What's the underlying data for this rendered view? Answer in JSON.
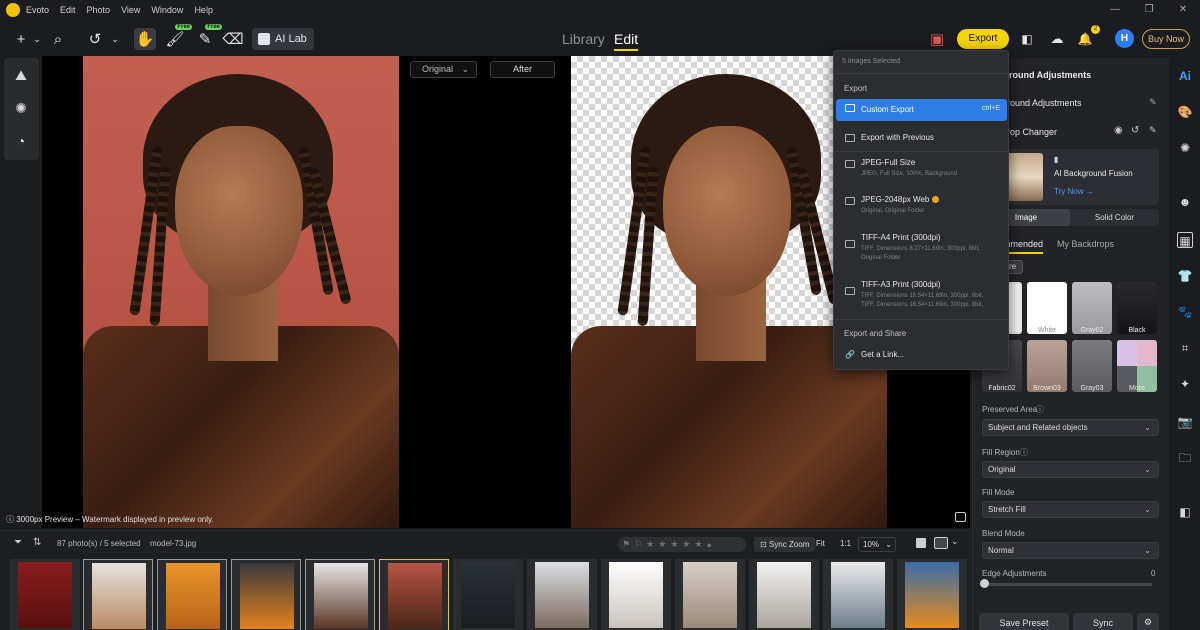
{
  "app": {
    "menu": [
      "Evoto",
      "Edit",
      "Photo",
      "View",
      "Window",
      "Help"
    ],
    "window_controls": [
      "—",
      "❐",
      "✕"
    ]
  },
  "toolbar": {
    "free_badge": "Free",
    "ai_lab_label": "AI Lab",
    "mode_library": "Library",
    "mode_edit": "Edit",
    "export_label": "Export",
    "notification_count": "2",
    "avatar_letter": "H",
    "buy_now_label": "Buy Now",
    "icons": [
      "plus-icon",
      "search-icon",
      "undo-icon",
      "hand-icon",
      "brush-icon",
      "eraser-icon",
      "ai-lab-icon",
      "export-history-icon",
      "crop-icon",
      "cloud-icon",
      "bell-icon"
    ]
  },
  "canvas": {
    "original_select": "Original",
    "after_label": "After",
    "preview_note": "3000px Preview – Watermark displayed in preview only."
  },
  "export_menu": {
    "header": "5 Images Selected",
    "section_export": "Export",
    "custom_export": "Custom Export",
    "custom_export_shortcut": "ctrl+E",
    "export_previous": "Export with Previous",
    "items": [
      {
        "title": "JPEG-Full Size",
        "sub": "JPEG, Full Size, 100%, Background"
      },
      {
        "title": "JPEG-2048px Web",
        "sub": "Original, Original Folder"
      },
      {
        "title": "TIFF-A4 Print (300dpi)",
        "sub": "TIFF, Dimensions 8.27×11.69in, 300ppi, 8bit,",
        "sub2": "Original Folder"
      },
      {
        "title": "TIFF-A3 Print (300dpi)",
        "sub": "TIFF, Dimensions 16.54×11.69in, 300ppi, 8bit,",
        "sub2": "TIFF, Dimensions 16.54×11.69in, 300ppi, 8bit,"
      }
    ],
    "section_share": "Export and Share",
    "get_link": "Get a Link..."
  },
  "filmstrip": {
    "count": "87 photo(s) / 5 selected",
    "filename": "model-73.jpg",
    "sync_zoom": "Sync Zoom",
    "fit": "Fit",
    "one_to_one": "1:1",
    "zoom": "10%",
    "stars": [
      "★",
      "★",
      "★",
      "★",
      "★"
    ]
  },
  "right_panel": {
    "title": "Background Adjustments",
    "sub_title": "Background Adjustments",
    "backdrop_changer": "Backdrop Changer",
    "ai_fusion_title": "AI Background Fusion",
    "ai_fusion_cta": "Try Now →",
    "tab_image": "Image",
    "tab_solid": "Solid Color",
    "tab_recommended": "Recommended",
    "tab_my_backdrops": "My Backdrops",
    "explore": "Explore",
    "swatches": [
      {
        "label": "",
        "color": "#f4f4f4"
      },
      {
        "label": "White",
        "color": "#ffffff"
      },
      {
        "label": "Gray02",
        "color": "#a9a9ab"
      },
      {
        "label": "Black",
        "color": "#1a1a1c"
      },
      {
        "label": "Fabric02",
        "color": "#3c3d40"
      },
      {
        "label": "Brown03",
        "color": "#a99086"
      },
      {
        "label": "Gray03",
        "color": "#6e6d72"
      },
      {
        "label": "More",
        "color": "#c9b6c4"
      }
    ],
    "preserved_area_label": "Preserved Area",
    "preserved_area_value": "Subject and Related objects",
    "fill_region_label": "Fill Region",
    "fill_region_value": "Original",
    "fill_mode_label": "Fill Mode",
    "fill_mode_value": "Stretch Fill",
    "blend_mode_label": "Blend Mode",
    "blend_mode_value": "Normal",
    "edge_adjustments_label": "Edge Adjustments",
    "edge_adjustments_value": "0",
    "save_preset": "Save Preset",
    "sync": "Sync"
  },
  "colors": {
    "accent": "#f5d400",
    "highlight": "#2f7de6"
  }
}
